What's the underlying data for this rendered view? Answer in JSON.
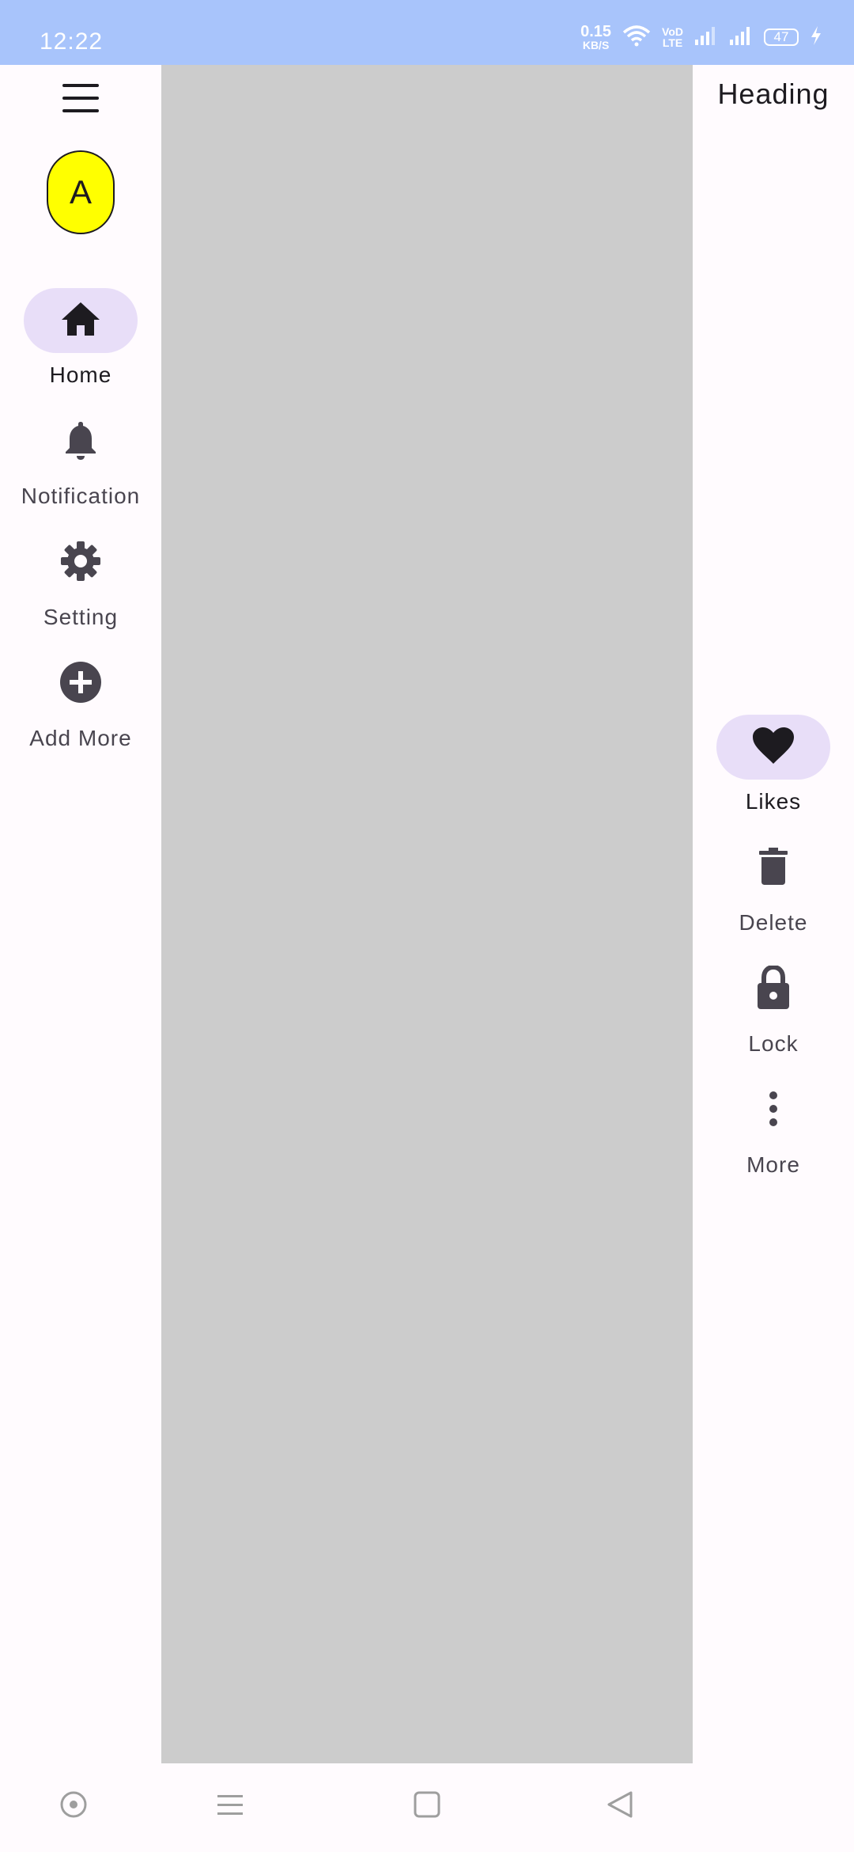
{
  "status_bar": {
    "time": "12:22",
    "net_speed_value": "0.15",
    "net_speed_unit": "KB/S",
    "volte_top": "VoD",
    "volte_bottom": "LTE",
    "battery": "47",
    "icons": [
      "wifi-icon",
      "volte-icon",
      "signal-icon",
      "signal-icon",
      "battery-icon",
      "charging-icon"
    ]
  },
  "left_rail": {
    "menu_icon": "menu-icon",
    "fab_label": "A",
    "fab_color": "#ffff00",
    "items": [
      {
        "label": "Home",
        "icon": "home-icon",
        "active": true
      },
      {
        "label": "Notification",
        "icon": "bell-icon",
        "active": false
      },
      {
        "label": "Setting",
        "icon": "gear-icon",
        "active": false
      },
      {
        "label": "Add More",
        "icon": "add-circle-icon",
        "active": false
      }
    ]
  },
  "right_rail": {
    "heading": "Heading",
    "items": [
      {
        "label": "Likes",
        "icon": "heart-icon",
        "active": true
      },
      {
        "label": "Delete",
        "icon": "trash-icon",
        "active": false
      },
      {
        "label": "Lock",
        "icon": "lock-icon",
        "active": false
      },
      {
        "label": "More",
        "icon": "more-vert-icon",
        "active": false
      }
    ]
  },
  "colors": {
    "status_bar": "#a8c4fb",
    "content": "#cccccc",
    "rail_background": "#fffbfe",
    "active_indicator": "#e8def8"
  },
  "nav_bar": {
    "icons": [
      "assistant-icon",
      "recents-icon",
      "home-button-icon",
      "back-icon"
    ]
  }
}
